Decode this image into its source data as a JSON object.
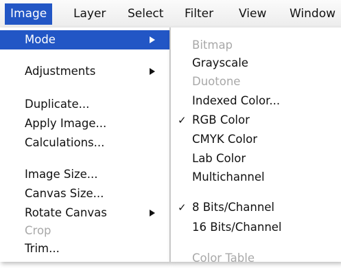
{
  "menubar": {
    "items": [
      {
        "label": "Image",
        "active": true
      },
      {
        "label": "Layer",
        "active": false
      },
      {
        "label": "Select",
        "active": false
      },
      {
        "label": "Filter",
        "active": false
      },
      {
        "label": "View",
        "active": false
      },
      {
        "label": "Window",
        "active": false
      }
    ]
  },
  "image_menu": {
    "items": [
      {
        "label": "Mode",
        "submenu": true,
        "highlighted": true
      },
      {
        "label": "Adjustments",
        "submenu": true
      },
      {
        "label": "Duplicate..."
      },
      {
        "label": "Apply Image..."
      },
      {
        "label": "Calculations..."
      },
      {
        "label": "Image Size..."
      },
      {
        "label": "Canvas Size..."
      },
      {
        "label": "Rotate Canvas",
        "submenu": true
      },
      {
        "label": "Crop",
        "disabled": true
      },
      {
        "label": "Trim..."
      }
    ]
  },
  "mode_submenu": {
    "items": [
      {
        "label": "Bitmap",
        "disabled": true
      },
      {
        "label": "Grayscale"
      },
      {
        "label": "Duotone",
        "disabled": true
      },
      {
        "label": "Indexed Color..."
      },
      {
        "label": "RGB Color",
        "checked": true
      },
      {
        "label": "CMYK Color"
      },
      {
        "label": "Lab Color"
      },
      {
        "label": "Multichannel"
      },
      {
        "label": "8 Bits/Channel",
        "checked": true
      },
      {
        "label": "16 Bits/Channel"
      },
      {
        "label": "Color Table",
        "disabled": true
      }
    ],
    "check_glyph": "✓"
  },
  "colors": {
    "highlight": "#2256c5",
    "disabled_text": "#a8a8a8"
  }
}
